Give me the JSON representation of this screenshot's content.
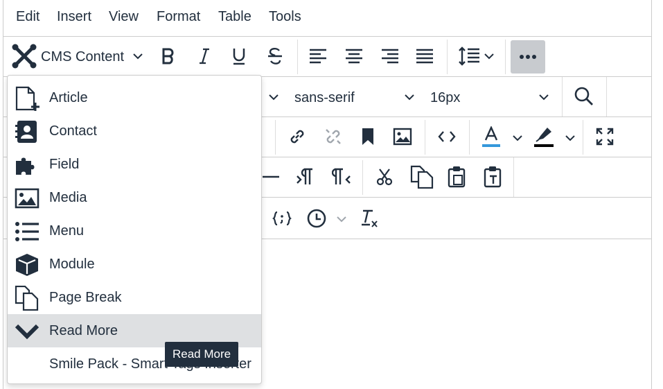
{
  "menubar": {
    "items": [
      "Edit",
      "Insert",
      "View",
      "Format",
      "Table",
      "Tools"
    ]
  },
  "toolbar": {
    "cms_content_label": "CMS Content",
    "font_family": "sans-serif",
    "font_size": "16px"
  },
  "dropdown": {
    "items": [
      {
        "label": "Article",
        "icon": "article-add-icon"
      },
      {
        "label": "Contact",
        "icon": "contact-card-icon"
      },
      {
        "label": "Field",
        "icon": "puzzle-icon"
      },
      {
        "label": "Media",
        "icon": "image-icon"
      },
      {
        "label": "Menu",
        "icon": "list-icon"
      },
      {
        "label": "Module",
        "icon": "cube-icon"
      },
      {
        "label": "Page Break",
        "icon": "copy-pages-icon"
      },
      {
        "label": "Read More",
        "icon": "chevron-down-icon"
      },
      {
        "label": "Smile Pack - Smart Tags Inserter",
        "icon": ""
      }
    ],
    "active_index": 7
  },
  "tooltip": {
    "text": "Read More"
  },
  "colors": {
    "text": "#222f3e",
    "active_bg": "#dee0e2",
    "text_color_underline": "#3598db",
    "highlight_underline": "#000000"
  }
}
